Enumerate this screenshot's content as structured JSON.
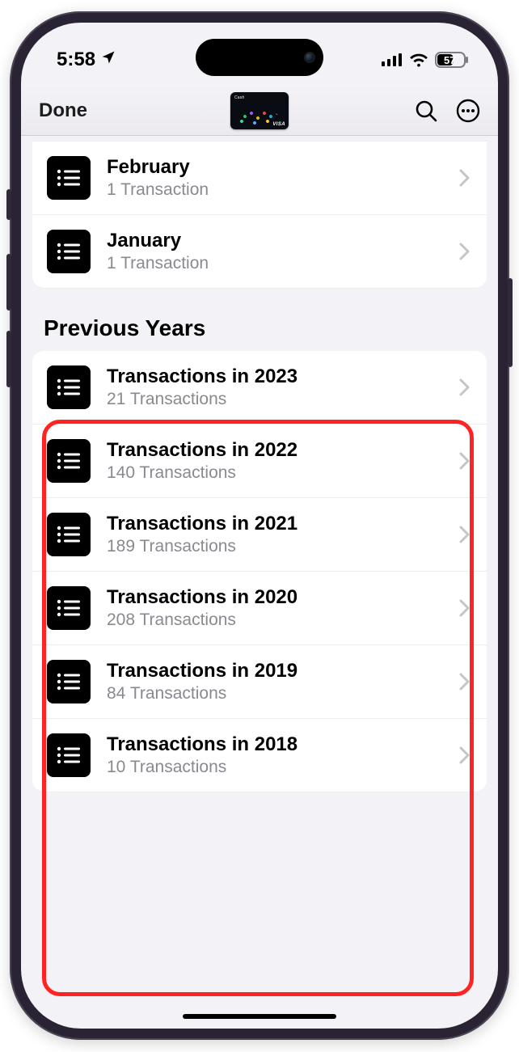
{
  "status": {
    "time": "5:58",
    "battery": "57"
  },
  "nav": {
    "done": "Done"
  },
  "months": [
    {
      "title": "February",
      "sub": "1 Transaction"
    },
    {
      "title": "January",
      "sub": "1 Transaction"
    }
  ],
  "section_header": "Previous Years",
  "years": [
    {
      "title": "Transactions in 2023",
      "sub": "21 Transactions"
    },
    {
      "title": "Transactions in 2022",
      "sub": "140 Transactions"
    },
    {
      "title": "Transactions in 2021",
      "sub": "189 Transactions"
    },
    {
      "title": "Transactions in 2020",
      "sub": "208 Transactions"
    },
    {
      "title": "Transactions in 2019",
      "sub": "84 Transactions"
    },
    {
      "title": "Transactions in 2018",
      "sub": "10 Transactions"
    }
  ]
}
